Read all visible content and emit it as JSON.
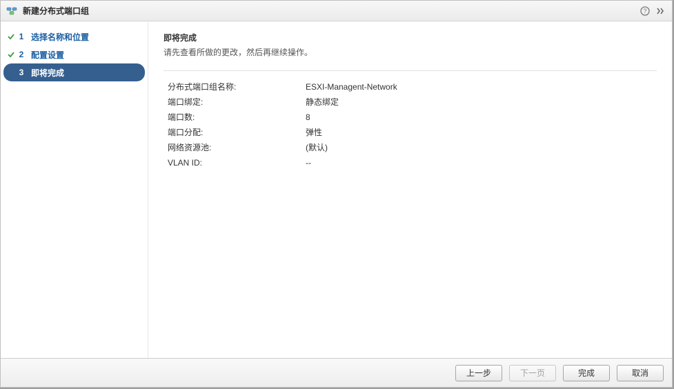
{
  "window": {
    "title": "新建分布式端口组"
  },
  "steps": [
    {
      "num": "1",
      "label": "选择名称和位置",
      "state": "done"
    },
    {
      "num": "2",
      "label": "配置设置",
      "state": "done"
    },
    {
      "num": "3",
      "label": "即将完成",
      "state": "active"
    }
  ],
  "main": {
    "title": "即将完成",
    "subtitle": "请先查看所做的更改，然后再继续操作。",
    "rows": [
      {
        "key": "分布式端口组名称:",
        "value": "ESXI-Managent-Network"
      },
      {
        "key": "端口绑定:",
        "value": "静态绑定"
      },
      {
        "key": "端口数:",
        "value": "8"
      },
      {
        "key": "端口分配:",
        "value": "弹性"
      },
      {
        "key": "网络资源池:",
        "value": "(默认)"
      },
      {
        "key": "VLAN ID:",
        "value": "--"
      }
    ]
  },
  "footer": {
    "back": "上一步",
    "next": "下一页",
    "finish": "完成",
    "cancel": "取消"
  }
}
